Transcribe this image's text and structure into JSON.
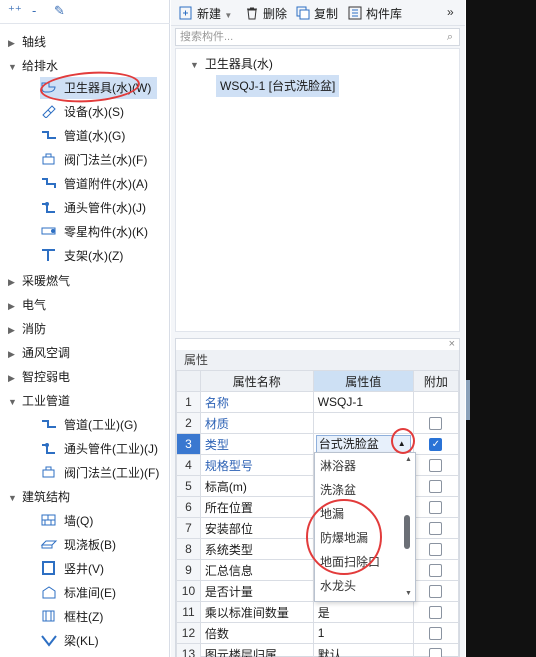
{
  "left_panel": {
    "toolbar": {
      "add_icon": "+",
      "collapse_icon": "-",
      "edit_icon": "✎"
    },
    "categories": [
      {
        "label": "轴线"
      },
      {
        "label": "给排水"
      },
      {
        "label": "采暖燃气"
      },
      {
        "label": "电气"
      },
      {
        "label": "消防"
      },
      {
        "label": "通风空调"
      },
      {
        "label": "智控弱电"
      },
      {
        "label": "工业管道"
      },
      {
        "label": "建筑结构"
      }
    ],
    "water_items": [
      {
        "label": "卫生器具(水)(W)",
        "icon": "toilet-icon"
      },
      {
        "label": "设备(水)(S)",
        "icon": "equipment-icon"
      },
      {
        "label": "管道(水)(G)",
        "icon": "pipe-icon"
      },
      {
        "label": "阀门法兰(水)(F)",
        "icon": "valve-icon"
      },
      {
        "label": "管道附件(水)(A)",
        "icon": "pipe-fitting-icon"
      },
      {
        "label": "通头管件(水)(J)",
        "icon": "tee-icon"
      },
      {
        "label": "零星构件(水)(K)",
        "icon": "misc-part-icon"
      },
      {
        "label": "支架(水)(Z)",
        "icon": "bracket-icon"
      }
    ],
    "industrial_items": [
      {
        "label": "管道(工业)(G)",
        "icon": "pipe-icon"
      },
      {
        "label": "通头管件(工业)(J)",
        "icon": "tee-icon"
      },
      {
        "label": "阀门法兰(工业)(F)",
        "icon": "valve-icon"
      }
    ],
    "structure_items": [
      {
        "label": "墙(Q)",
        "icon": "wall-icon"
      },
      {
        "label": "现浇板(B)",
        "icon": "slab-icon"
      },
      {
        "label": "竖井(V)",
        "icon": "shaft-icon"
      },
      {
        "label": "标准间(E)",
        "icon": "room-icon"
      },
      {
        "label": "框柱(Z)",
        "icon": "column-icon"
      },
      {
        "label": "梁(KL)",
        "icon": "beam-icon"
      }
    ]
  },
  "right_panel": {
    "toolbar": {
      "new_label": "新建",
      "delete_label": "删除",
      "copy_label": "复制",
      "library_label": "构件库",
      "more": "»"
    },
    "search": {
      "placeholder": "搜索构件..."
    },
    "tree": {
      "group": "卫生器具(水)",
      "item": "WSQJ-1 [台式洗脸盆]"
    },
    "properties": {
      "title": "属性",
      "columns": [
        "属性名称",
        "属性值",
        "附加"
      ],
      "rows": [
        {
          "n": "1",
          "name": "名称",
          "value": "WSQJ-1",
          "blue": true,
          "check": "none"
        },
        {
          "n": "2",
          "name": "材质",
          "value": "",
          "blue": true,
          "check": "off"
        },
        {
          "n": "3",
          "name": "类型",
          "value": "台式洗脸盆",
          "blue": true,
          "check": "on"
        },
        {
          "n": "4",
          "name": "规格型号",
          "value": "",
          "blue": true,
          "check": "off"
        },
        {
          "n": "5",
          "name": "标高(m)",
          "value": "",
          "blue": false,
          "check": "off"
        },
        {
          "n": "6",
          "name": "所在位置",
          "value": "",
          "blue": false,
          "check": "off"
        },
        {
          "n": "7",
          "name": "安装部位",
          "value": "",
          "blue": false,
          "check": "off"
        },
        {
          "n": "8",
          "name": "系统类型",
          "value": "",
          "blue": false,
          "check": "off"
        },
        {
          "n": "9",
          "name": "汇总信息",
          "value": "",
          "blue": false,
          "check": "off"
        },
        {
          "n": "10",
          "name": "是否计量",
          "value": "",
          "blue": false,
          "check": "off"
        },
        {
          "n": "11",
          "name": "乘以标准间数量",
          "value": "是",
          "blue": false,
          "check": "off"
        },
        {
          "n": "12",
          "name": "倍数",
          "value": "1",
          "blue": false,
          "check": "off"
        },
        {
          "n": "13",
          "name": "图元楼层归属",
          "value": "默认",
          "blue": false,
          "check": "off"
        }
      ]
    },
    "dropdown": {
      "options": [
        "淋浴器",
        "洗涤盆",
        "地漏",
        "防爆地漏",
        "地面扫除口",
        "水龙头"
      ]
    }
  },
  "colors": {
    "accent": "#2a73d6",
    "highlight": "#cfe0f5",
    "annotation": "#e23b3b"
  }
}
